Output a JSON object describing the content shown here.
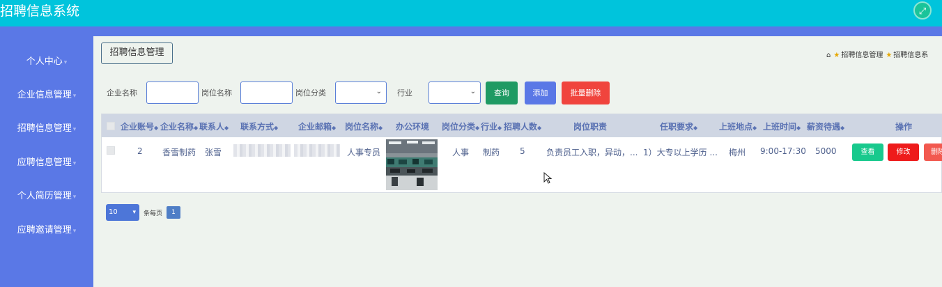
{
  "header": {
    "app_title": "招聘信息系统",
    "expand_icon": "expand-icon"
  },
  "sidebar": {
    "items": [
      {
        "label": "个人中心"
      },
      {
        "label": "企业信息管理"
      },
      {
        "label": "招聘信息管理"
      },
      {
        "label": "应聘信息管理"
      },
      {
        "label": "个人简历管理"
      },
      {
        "label": "应聘邀请管理"
      }
    ]
  },
  "breadcrumb": {
    "box_label": "招聘信息管理",
    "trail": [
      "招聘信息管理",
      "招聘信息系"
    ]
  },
  "search": {
    "company_name_label": "企业名称",
    "company_name_value": "",
    "job_name_label": "岗位名称",
    "job_name_value": "",
    "job_category_label": "岗位分类",
    "job_category_value": "",
    "industry_label": "行业",
    "industry_value": "",
    "query_button": "查询",
    "add_button": "添加",
    "batch_delete_button": "批量删除"
  },
  "table": {
    "columns": [
      "企业账号",
      "企业名称",
      "联系人",
      "联系方式",
      "企业邮箱",
      "岗位名称",
      "办公环境",
      "岗位分类",
      "行业",
      "招聘人数",
      "岗位职责",
      "任职要求",
      "上班地点",
      "上班时间",
      "薪资待遇",
      "操作"
    ],
    "rows": [
      {
        "company_account": "2",
        "company_name": "香雪制药",
        "contact": "张雪",
        "phone": "",
        "email": "",
        "job_name": "人事专员",
        "job_category": "人事",
        "industry": "制药",
        "headcount": "5",
        "duties": "负责员工入职，异动，...",
        "requirements": "1）大专以上学历 ...",
        "location": "梅州",
        "work_time": "9:00-17:30",
        "salary": "5000"
      }
    ],
    "actions": {
      "view": "查看",
      "edit": "修改",
      "delete": "删除"
    }
  },
  "pagination": {
    "page_size": "10",
    "per_page_label": "条每页",
    "current_page": "1"
  },
  "colors": {
    "topbar": "#00c4dc",
    "sidebar": "#5a78e6",
    "query": "#1f9a63",
    "add": "#5a78e6",
    "batch_delete": "#f0443d",
    "view": "#18c98d",
    "edit": "#ee1b1b",
    "delete": "#f2594f"
  }
}
